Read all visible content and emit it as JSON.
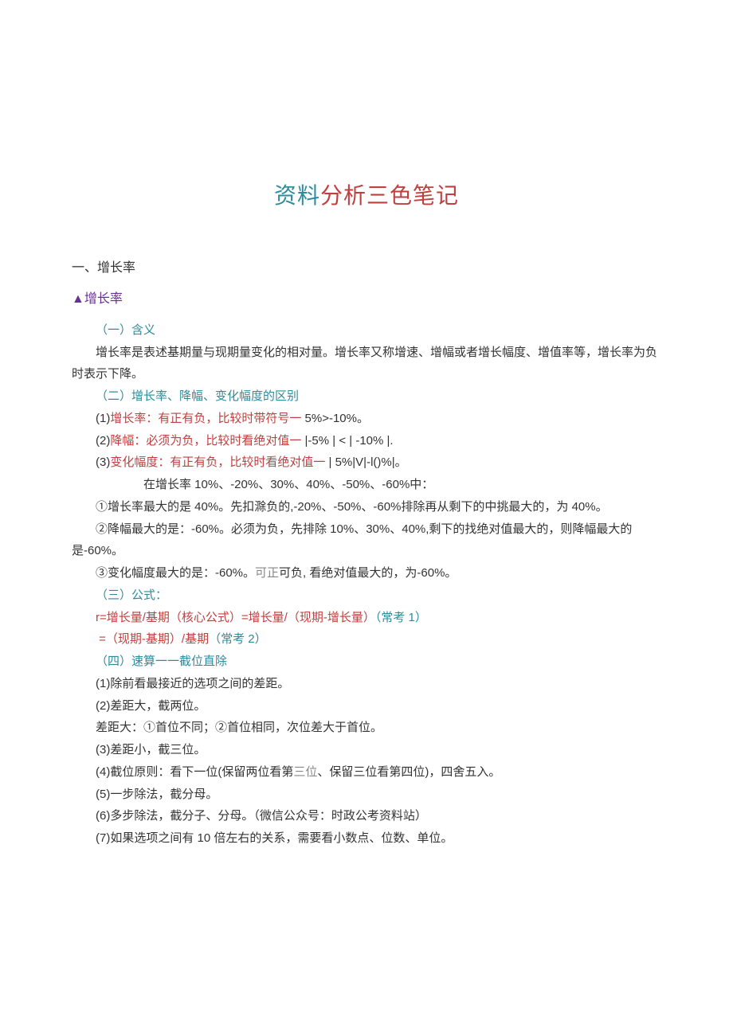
{
  "title": {
    "part1": "资料",
    "part2": "分析三色笔记"
  },
  "section1": {
    "heading": "一、增长率",
    "subheading": "▲增长率",
    "s1": {
      "head": "（一）含义",
      "p1": "增长率是表述基期量与现期量变化的相对量。增长率又称增速、增幅或者增长幅度、增值率等，增长率为负时表示下降。"
    },
    "s2": {
      "head": "（二）增长率、降幅、变化幅度的区别",
      "l1a": "(1)",
      "l1b": "增长率：有正有负，比较时带符号一",
      "l1c": " 5%>-10%。",
      "l2a": "(2)",
      "l2b": "降幅：必须为负，比较时看绝对值一",
      "l2c": " |-5% | < | -10% |.",
      "l3a": "(3)",
      "l3b": "变化幅度：有正有负，比较时看绝对值一",
      "l3c": " | 5%|V|-l()%|。",
      "p4": "在增长率 10%、-20%、30%、40%、-50%、-60%中：",
      "p5": "①增长率最大的是 40%。先扣滁负的,-20%、-50%、-60%排除再从剩下的中挑最大的，为 40%。",
      "p6": "②降幅最大的是：-60%。必须为负，先排除 10%、30%、40%,剩下的找绝对值最大的，则降幅最大的是-60%。",
      "p7a": "③变化幅度最大的是：-60%。",
      "p7b": "可正",
      "p7c": "可负,  看绝对值最大的，为-60%。"
    },
    "s3": {
      "head": "（三）公式：",
      "l1a": "r=增长量/基期（核心公式）=增长量/（现期-增长量）",
      "l1b": "（常考 1）",
      "l2a": "=（现期-基期）/基期",
      "l2b": "（常考 2）"
    },
    "s4": {
      "head": "（四）速算一一截位直除",
      "p1": "(1)除前看最接近的选项之间的差距。",
      "p2": "(2)差距大，截两位。",
      "p3": "差距大：①首位不同；②首位相同，次位差大于首位。",
      "p4": "(3)差距小，截三位。",
      "p5a": "(4)截位原则：看下一位(保留两位看第",
      "p5b": "三位",
      "p5c": "、保留三位看第四位)，四舍五入。",
      "p6": "(5)一步除法，截分母。",
      "p7": "(6)多步除法，截分子、分母。（微信公众号：时政公考资料站）",
      "p8": "(7)如果选项之间有 10 倍左右的关系，需要看小数点、位数、单位。"
    }
  }
}
